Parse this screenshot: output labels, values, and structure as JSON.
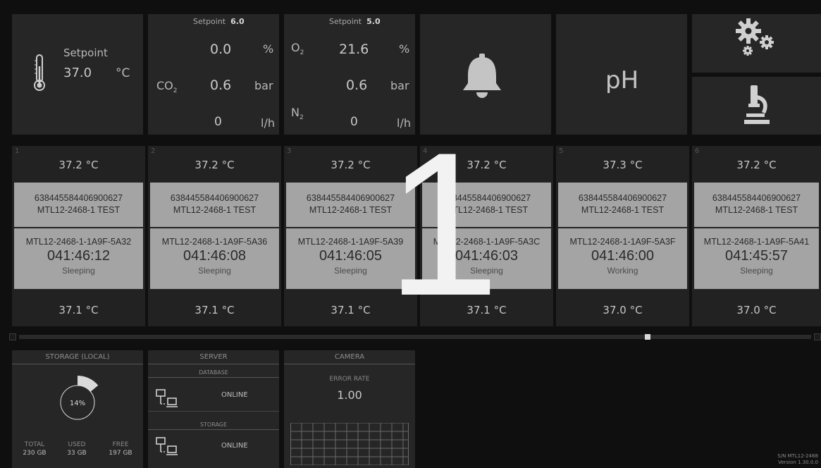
{
  "temperature": {
    "label": "Setpoint",
    "value": "37.0",
    "unit": "°C"
  },
  "co2": {
    "setpoint_label": "Setpoint",
    "setpoint_value": "6.0",
    "gas_label": "CO",
    "gas_sub": "2",
    "rows": [
      {
        "value": "0.0",
        "unit": "%"
      },
      {
        "value": "0.6",
        "unit": "bar"
      },
      {
        "value": "0",
        "unit": "l/h"
      }
    ]
  },
  "o2": {
    "setpoint_label": "Setpoint",
    "setpoint_value": "5.0",
    "gas_label": "O",
    "gas_sub": "2",
    "n2_label": "N",
    "n2_sub": "2",
    "rows": [
      {
        "value": "21.6",
        "unit": "%"
      },
      {
        "value": "0.6",
        "unit": "bar"
      },
      {
        "value": "0",
        "unit": "l/h"
      }
    ]
  },
  "ph": {
    "label": "pH"
  },
  "overlay_number": "1",
  "chambers": [
    {
      "num": "1",
      "temp_top": "37.2 °C",
      "id1": "638445584406900627",
      "id2": "MTL12-2468-1 TEST",
      "code": "MTL12-2468-1-1A9F-5A32",
      "time": "041:46:12",
      "status": "Sleeping",
      "temp_bottom": "37.1 °C"
    },
    {
      "num": "2",
      "temp_top": "37.2 °C",
      "id1": "638445584406900627",
      "id2": "MTL12-2468-1 TEST",
      "code": "MTL12-2468-1-1A9F-5A36",
      "time": "041:46:08",
      "status": "Sleeping",
      "temp_bottom": "37.1 °C"
    },
    {
      "num": "3",
      "temp_top": "37.2 °C",
      "id1": "638445584406900627",
      "id2": "MTL12-2468-1 TEST",
      "code": "MTL12-2468-1-1A9F-5A39",
      "time": "041:46:05",
      "status": "Sleeping",
      "temp_bottom": "37.1 °C"
    },
    {
      "num": "4",
      "temp_top": "37.2 °C",
      "id1": "638445584406900627",
      "id2": "MTL12-2468-1 TEST",
      "code": "MTL12-2468-1-1A9F-5A3C",
      "time": "041:46:03",
      "status": "Sleeping",
      "temp_bottom": "37.1 °C"
    },
    {
      "num": "5",
      "temp_top": "37.3 °C",
      "id1": "638445584406900627",
      "id2": "MTL12-2468-1 TEST",
      "code": "MTL12-2468-1-1A9F-5A3F",
      "time": "041:46:00",
      "status": "Working",
      "temp_bottom": "37.0 °C"
    },
    {
      "num": "6",
      "temp_top": "37.2 °C",
      "id1": "638445584406900627",
      "id2": "MTL12-2468-1 TEST",
      "code": "MTL12-2468-1-1A9F-5A41",
      "time": "041:45:57",
      "status": "Sleeping",
      "temp_bottom": "37.0 °C"
    }
  ],
  "scrollbar": {
    "position_fraction": 0.79
  },
  "storage": {
    "title": "STORAGE (LOCAL)",
    "percent_label": "14%",
    "used_fraction": 0.14,
    "total_label": "TOTAL",
    "total_value": "230 GB",
    "used_label": "USED",
    "used_value": "33 GB",
    "free_label": "FREE",
    "free_value": "197 GB"
  },
  "server": {
    "title": "SERVER",
    "database_label": "DATABASE",
    "database_status": "ONLINE",
    "storage_label": "STORAGE",
    "storage_status": "ONLINE"
  },
  "camera": {
    "title": "CAMERA",
    "error_label": "ERROR RATE",
    "error_value": "1.00"
  },
  "footer": {
    "serial": "S/N MTL12-2468",
    "version": "Version 1.30.0.0"
  }
}
